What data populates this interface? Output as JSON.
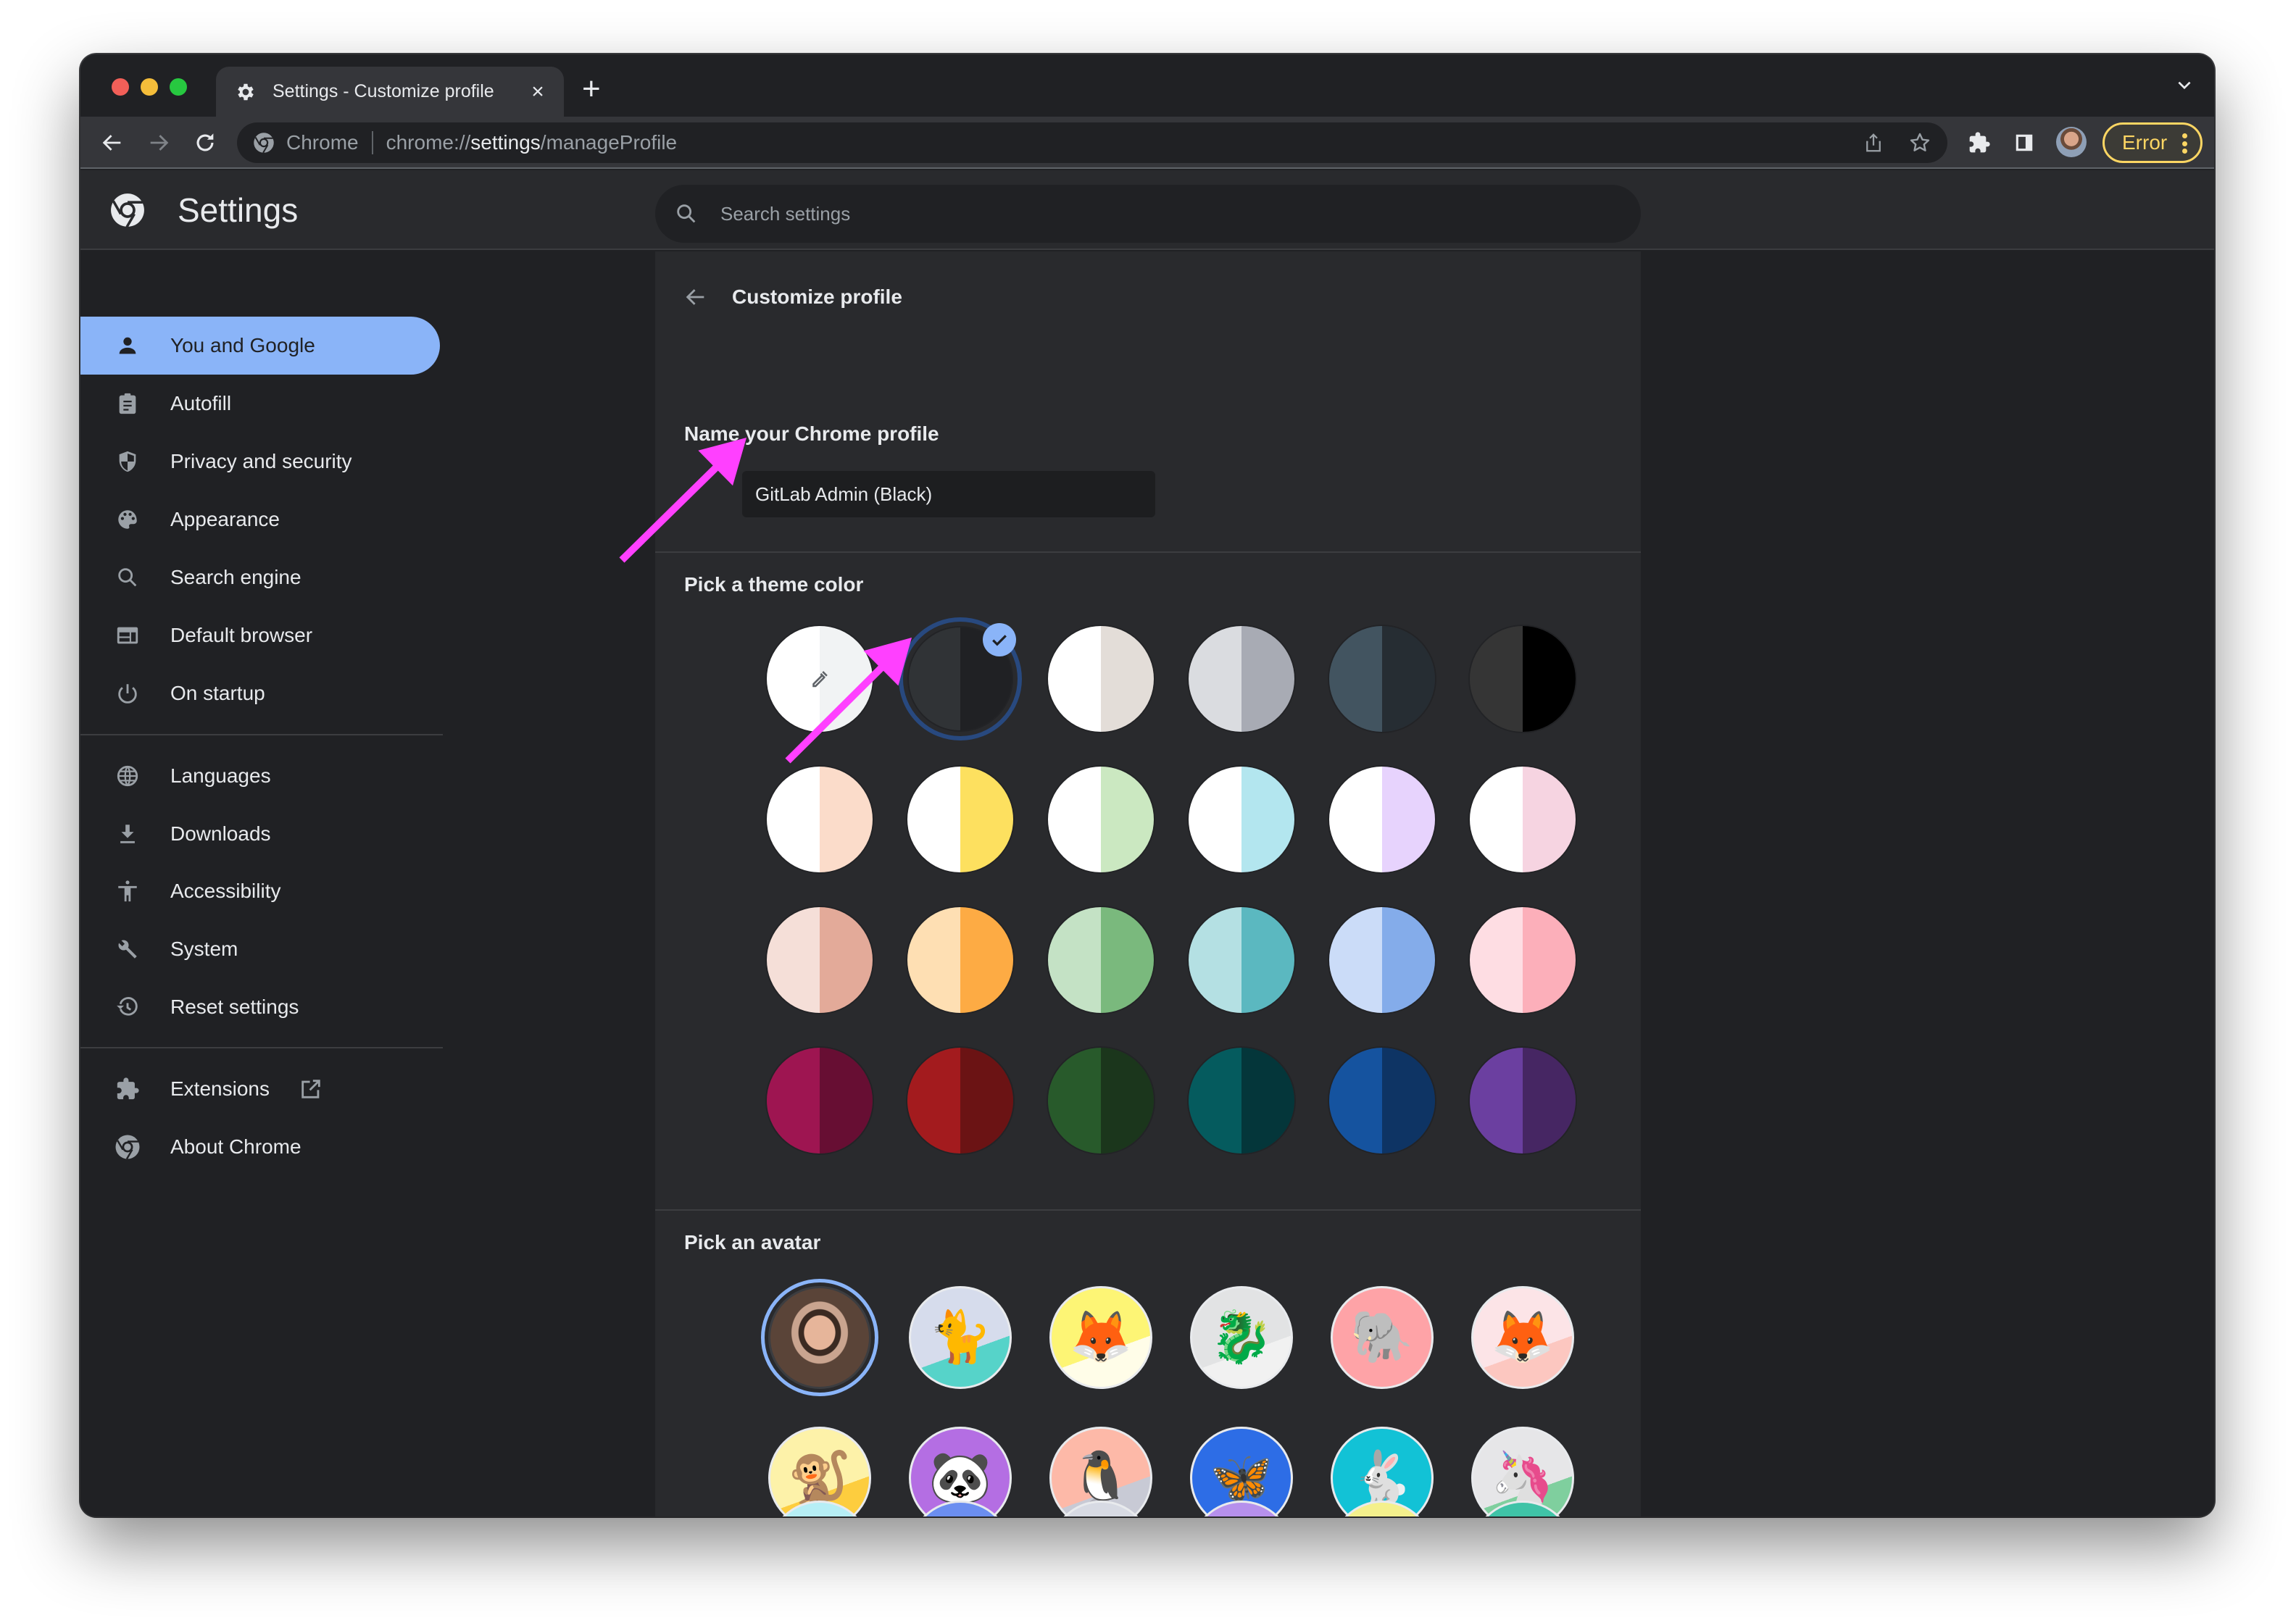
{
  "window": {
    "tab_title": "Settings - Customize profile",
    "tab_close": "×",
    "new_tab": "+"
  },
  "toolbar": {
    "omnibox_chip": "Chrome",
    "url_scheme": "chrome://",
    "url_host": "settings",
    "url_path": "/manageProfile",
    "profile_status": "Error"
  },
  "settings": {
    "title": "Settings",
    "search_placeholder": "Search settings"
  },
  "sidebar": {
    "items": [
      {
        "label": "You and Google",
        "icon": "person-icon",
        "active": true
      },
      {
        "label": "Autofill",
        "icon": "clipboard-icon"
      },
      {
        "label": "Privacy and security",
        "icon": "shield-icon"
      },
      {
        "label": "Appearance",
        "icon": "palette-icon"
      },
      {
        "label": "Search engine",
        "icon": "search-icon"
      },
      {
        "label": "Default browser",
        "icon": "browser-window-icon"
      },
      {
        "label": "On startup",
        "icon": "power-icon"
      },
      {
        "label": "Languages",
        "icon": "globe-icon"
      },
      {
        "label": "Downloads",
        "icon": "download-icon"
      },
      {
        "label": "Accessibility",
        "icon": "accessibility-icon"
      },
      {
        "label": "System",
        "icon": "wrench-icon"
      },
      {
        "label": "Reset settings",
        "icon": "history-icon"
      },
      {
        "label": "Extensions",
        "icon": "puzzle-icon",
        "external": true
      },
      {
        "label": "About Chrome",
        "icon": "chrome-icon"
      }
    ]
  },
  "main": {
    "page_title": "Customize profile",
    "name_label": "Name your Chrome profile",
    "name_value": "GitLab Admin (Black)",
    "theme_label": "Pick a theme color",
    "theme_colors": [
      {
        "left": "#ffffff",
        "right": "#f1f3f4",
        "custom": true
      },
      {
        "left": "#303336",
        "right": "#202124",
        "selected": true
      },
      {
        "left": "#ffffff",
        "right": "#e3ddd8"
      },
      {
        "left": "#dadce0",
        "right": "#a8abb4"
      },
      {
        "left": "#425460",
        "right": "#262d33"
      },
      {
        "left": "#353535",
        "right": "#000000"
      },
      {
        "left": "#ffffff",
        "right": "#fbdcca"
      },
      {
        "left": "#ffffff",
        "right": "#fde05f"
      },
      {
        "left": "#ffffff",
        "right": "#cbe8c1"
      },
      {
        "left": "#ffffff",
        "right": "#b3e6ef"
      },
      {
        "left": "#ffffff",
        "right": "#e7d3fd"
      },
      {
        "left": "#ffffff",
        "right": "#f6d4e1"
      },
      {
        "left": "#f5dfd8",
        "right": "#e3aa99"
      },
      {
        "left": "#fedfb3",
        "right": "#fdab44"
      },
      {
        "left": "#c4e2c5",
        "right": "#7ab97d"
      },
      {
        "left": "#b4e0e3",
        "right": "#5bb8c0"
      },
      {
        "left": "#cbdcf8",
        "right": "#84acea"
      },
      {
        "left": "#fedde3",
        "right": "#fcafba"
      },
      {
        "left": "#9e1551",
        "right": "#670e33"
      },
      {
        "left": "#a31b1e",
        "right": "#6b1314"
      },
      {
        "left": "#285a2b",
        "right": "#1b361c"
      },
      {
        "left": "#055b5e",
        "right": "#04363a"
      },
      {
        "left": "#15539f",
        "right": "#0e3464"
      },
      {
        "left": "#6b3fa0",
        "right": "#462663"
      }
    ],
    "avatar_label": "Pick an avatar",
    "avatars": [
      {
        "name": "profile-photo",
        "bg": "#8d7266",
        "glyph": "",
        "selected": true
      },
      {
        "name": "origami-cat",
        "bg": "#d6dcec",
        "accent": "#56d3c9",
        "glyph": "🐈"
      },
      {
        "name": "origami-fox-dog",
        "bg": "#fdf575",
        "accent": "#fffde8",
        "glyph": "🦊"
      },
      {
        "name": "origami-dragon",
        "bg": "#e2e3e4",
        "accent": "#f1f1f1",
        "glyph": "🐉"
      },
      {
        "name": "origami-elephant",
        "bg": "#fea3a7",
        "accent": "#fea3a7",
        "glyph": "🐘"
      },
      {
        "name": "origami-fox",
        "bg": "#fce4e7",
        "accent": "#fcc7c0",
        "glyph": "🦊"
      },
      {
        "name": "origami-monkey",
        "bg": "#fdf2a9",
        "accent": "#fdcd3e",
        "glyph": "🐒"
      },
      {
        "name": "origami-panda",
        "bg": "#b46ee3",
        "accent": "#b46ee3",
        "glyph": "🐼"
      },
      {
        "name": "origami-penguin",
        "bg": "#fdb9a8",
        "accent": "#c8cad5",
        "glyph": "🐧"
      },
      {
        "name": "origami-butterfly",
        "bg": "#2d6de6",
        "accent": "#2d6de6",
        "glyph": "🦋"
      },
      {
        "name": "origami-rabbit",
        "bg": "#12c2d6",
        "accent": "#12c2d6",
        "glyph": "🐇"
      },
      {
        "name": "origami-unicorn",
        "bg": "#e6e6e8",
        "accent": "#7fcf9e",
        "glyph": "🦄"
      }
    ],
    "avatars_partial_row": [
      "#b6eef5",
      "#6b8ef0",
      "#d7dae3",
      "#b690ec",
      "#f4f08c",
      "#3fc3a7"
    ]
  },
  "annotations": {
    "arrow_color": "#ff40ff"
  }
}
